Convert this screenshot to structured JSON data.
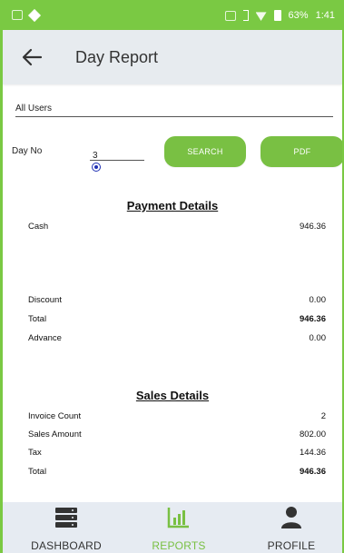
{
  "status_bar": {
    "battery": "63%",
    "time": "1:41"
  },
  "app_bar": {
    "title": "Day Report"
  },
  "filters": {
    "users_value": "All Users",
    "day_label": "Day No",
    "day_value": "3",
    "search_label": "SEARCH",
    "pdf_label": "PDF"
  },
  "payment": {
    "title": "Payment Details",
    "cash": {
      "label": "Cash",
      "value": "946.36"
    },
    "discount": {
      "label": "Discount",
      "value": "0.00"
    },
    "total": {
      "label": "Total",
      "value": "946.36"
    },
    "advance": {
      "label": "Advance",
      "value": "0.00"
    }
  },
  "sales": {
    "title": "Sales Details",
    "invoice_count": {
      "label": "Invoice Count",
      "value": "2"
    },
    "sales_amount": {
      "label": "Sales Amount",
      "value": "802.00"
    },
    "tax": {
      "label": "Tax",
      "value": "144.36"
    },
    "total": {
      "label": "Total",
      "value": "946.36"
    }
  },
  "nav": [
    {
      "label": "DASHBOARD",
      "icon": "dashboard-icon"
    },
    {
      "label": "REPORTS",
      "icon": "reports-icon"
    },
    {
      "label": "PROFILE",
      "icon": "profile-icon"
    }
  ],
  "colors": {
    "accent": "#79c043",
    "appbar_bg": "#e7ebef",
    "radio": "#1e2fb3"
  }
}
